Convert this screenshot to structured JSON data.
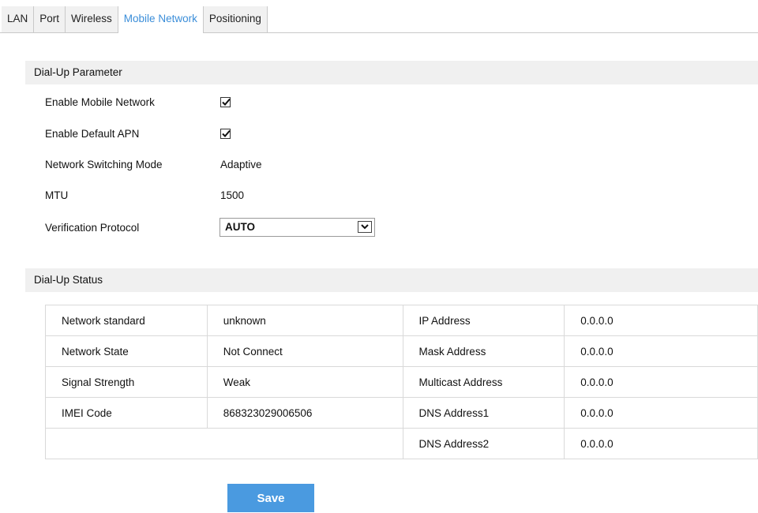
{
  "tabs": [
    {
      "label": "LAN",
      "active": false
    },
    {
      "label": "Port",
      "active": false
    },
    {
      "label": "Wireless",
      "active": false
    },
    {
      "label": "Mobile Network",
      "active": true
    },
    {
      "label": "Positioning",
      "active": false
    }
  ],
  "dialup_parameter": {
    "title": "Dial-Up Parameter",
    "enable_mobile_network": {
      "label": "Enable Mobile Network",
      "checked": true
    },
    "enable_default_apn": {
      "label": "Enable Default APN",
      "checked": true
    },
    "network_switching_mode": {
      "label": "Network Switching Mode",
      "value": "Adaptive"
    },
    "mtu": {
      "label": "MTU",
      "value": "1500"
    },
    "verification_protocol": {
      "label": "Verification Protocol",
      "value": "AUTO"
    }
  },
  "dialup_status": {
    "title": "Dial-Up Status",
    "rows": [
      {
        "label1": "Network standard",
        "value1": "unknown",
        "label2": "IP Address",
        "value2": "0.0.0.0"
      },
      {
        "label1": "Network State",
        "value1": "Not Connect",
        "label2": "Mask Address",
        "value2": "0.0.0.0"
      },
      {
        "label1": "Signal Strength",
        "value1": "Weak",
        "label2": "Multicast Address",
        "value2": "0.0.0.0"
      },
      {
        "label1": "IMEI Code",
        "value1": "868323029006506",
        "label2": "DNS Address1",
        "value2": "0.0.0.0"
      },
      {
        "label1": "",
        "value1": "",
        "label2": "DNS Address2",
        "value2": "0.0.0.0"
      }
    ]
  },
  "save_label": "Save",
  "colors": {
    "accent": "#3b8ed9",
    "save_button": "#4a9ae0",
    "section_header_bg": "#f0f0f0"
  },
  "icons": {
    "checkbox_mark": "check-icon",
    "select_arrow": "chevron-down-icon"
  }
}
